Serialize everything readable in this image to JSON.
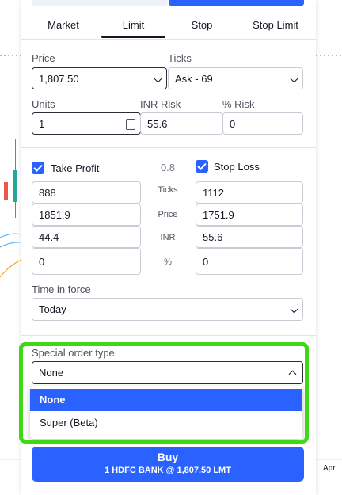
{
  "tabs": [
    "Market",
    "Limit",
    "Stop",
    "Stop Limit"
  ],
  "price": {
    "label": "Price",
    "value": "1,807.50"
  },
  "ticks": {
    "label": "Ticks",
    "value": "Ask - 69"
  },
  "units": {
    "label": "Units",
    "value": "1"
  },
  "inr_risk": {
    "label": "INR Risk",
    "value": "55.6"
  },
  "pct_risk": {
    "label": "% Risk",
    "value": "0"
  },
  "take_profit": {
    "label": "Take Profit",
    "ticks": "888",
    "price": "1851.9",
    "inr": "44.4",
    "pct": "0"
  },
  "ratio": "0.8",
  "stop_loss": {
    "label": "Stop Loss",
    "ticks": "1112",
    "price": "1751.9",
    "inr": "55.6",
    "pct": "0"
  },
  "mid_labels": {
    "ticks": "Ticks",
    "price": "Price",
    "inr": "INR",
    "pct": "%"
  },
  "tif": {
    "label": "Time in force",
    "value": "Today"
  },
  "special": {
    "label": "Special order type",
    "value": "None",
    "options": [
      "None",
      "Super (Beta)"
    ]
  },
  "buy": {
    "title": "Buy",
    "subtitle": "1 HDFC BANK @ 1,807.50 LMT"
  },
  "chart_bits": {
    "axis_month": "Apr"
  },
  "colors": {
    "accent": "#2962ff",
    "highlight": "#3ed817"
  }
}
